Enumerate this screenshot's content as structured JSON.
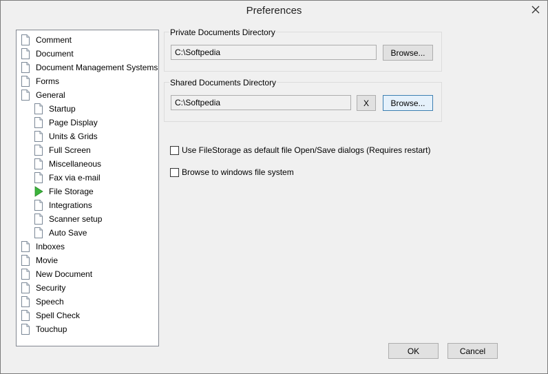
{
  "window": {
    "title": "Preferences"
  },
  "tree": {
    "items": [
      {
        "label": "Comment",
        "level": 0,
        "icon": "page-icon"
      },
      {
        "label": "Document",
        "level": 0,
        "icon": "page-icon"
      },
      {
        "label": "Document Management Systems",
        "level": 0,
        "icon": "page-icon"
      },
      {
        "label": "Forms",
        "level": 0,
        "icon": "page-icon"
      },
      {
        "label": "General",
        "level": 0,
        "icon": "page-icon"
      },
      {
        "label": "Startup",
        "level": 1,
        "icon": "page-icon"
      },
      {
        "label": "Page Display",
        "level": 1,
        "icon": "page-icon"
      },
      {
        "label": "Units & Grids",
        "level": 1,
        "icon": "page-icon"
      },
      {
        "label": "Full Screen",
        "level": 1,
        "icon": "page-icon"
      },
      {
        "label": "Miscellaneous",
        "level": 1,
        "icon": "page-icon"
      },
      {
        "label": "Fax via e-mail",
        "level": 1,
        "icon": "page-icon"
      },
      {
        "label": "File Storage",
        "level": 1,
        "icon": "play-arrow-icon",
        "selected": true
      },
      {
        "label": "Integrations",
        "level": 1,
        "icon": "page-icon"
      },
      {
        "label": "Scanner setup",
        "level": 1,
        "icon": "page-icon"
      },
      {
        "label": "Auto Save",
        "level": 1,
        "icon": "page-icon"
      },
      {
        "label": "Inboxes",
        "level": 0,
        "icon": "page-icon"
      },
      {
        "label": "Movie",
        "level": 0,
        "icon": "page-icon"
      },
      {
        "label": "New Document",
        "level": 0,
        "icon": "page-icon"
      },
      {
        "label": "Security",
        "level": 0,
        "icon": "page-icon"
      },
      {
        "label": "Speech",
        "level": 0,
        "icon": "page-icon"
      },
      {
        "label": "Spell Check",
        "level": 0,
        "icon": "page-icon"
      },
      {
        "label": "Touchup",
        "level": 0,
        "icon": "page-icon"
      }
    ]
  },
  "private_dir": {
    "label": "Private Documents Directory",
    "value": "C:\\Softpedia",
    "browse_label": "Browse..."
  },
  "shared_dir": {
    "label": "Shared Documents Directory",
    "value": "C:\\Softpedia",
    "clear_label": "X",
    "browse_label": "Browse..."
  },
  "options": {
    "use_filestorage_label": "Use FileStorage as default file Open/Save dialogs (Requires restart)",
    "use_filestorage_checked": false,
    "browse_windows_label": "Browse to windows  file system",
    "browse_windows_checked": false
  },
  "footer": {
    "ok_label": "OK",
    "cancel_label": "Cancel"
  },
  "colors": {
    "accent_arrow": "#3cb43c",
    "focus_border": "#3c7fb1"
  }
}
